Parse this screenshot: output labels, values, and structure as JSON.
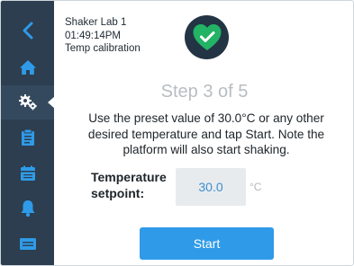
{
  "header": {
    "device_name": "Shaker Lab 1",
    "time": "01:49:14PM",
    "screen_title": "Temp calibration",
    "status_icon": "heart-check-icon",
    "status_color": "#22b365"
  },
  "sidebar": {
    "items": [
      {
        "icon": "back-chevron-icon"
      },
      {
        "icon": "home-icon"
      },
      {
        "icon": "settings-gears-icon",
        "active": true
      },
      {
        "icon": "clipboard-icon"
      },
      {
        "icon": "calendar-icon"
      },
      {
        "icon": "bell-icon"
      },
      {
        "icon": "message-icon"
      }
    ]
  },
  "main": {
    "step": "Step 3 of 5",
    "instructions": "Use the preset value of 30.0°C or any other desired temperature and tap Start. Note the platform will also start shaking.",
    "setpoint": {
      "label_line1": "Temperature",
      "label_line2": "setpoint:",
      "value": "30.0",
      "unit": "°C"
    },
    "start_label": "Start"
  },
  "colors": {
    "sidebar": "#2c3e4f",
    "accent": "#2f9be8",
    "icon_blue": "#2f9be8"
  }
}
